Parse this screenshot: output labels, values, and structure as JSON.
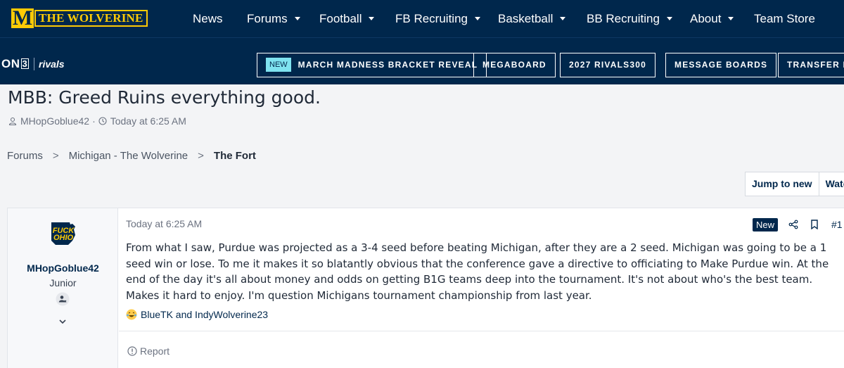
{
  "header": {
    "logo_letter": "M",
    "logo_text": "THE WOLVERINE",
    "nav": [
      {
        "label": "News",
        "has_caret": false
      },
      {
        "label": "Forums",
        "has_caret": true
      },
      {
        "label": "Football",
        "has_caret": true
      },
      {
        "label": "FB Recruiting",
        "has_caret": true
      },
      {
        "label": "Basketball",
        "has_caret": true
      },
      {
        "label": "BB Recruiting",
        "has_caret": true
      },
      {
        "label": "About",
        "has_caret": true
      },
      {
        "label": "Team Store",
        "has_caret": false
      }
    ]
  },
  "subbar": {
    "on3_a": "ON",
    "on3_b": "3",
    "rivals": "rivals",
    "new_tag": "NEW",
    "pills": [
      "MARCH MADNESS BRACKET REVEAL",
      "MEGABOARD",
      "2027 RIVALS300",
      "MESSAGE BOARDS",
      "TRANSFER P"
    ]
  },
  "thread": {
    "title": "MBB: Greed Ruins everything good.",
    "author": "MHopGoblue42",
    "separator": "·",
    "time": "Today at 6:25 AM"
  },
  "breadcrumb": {
    "items": [
      "Forums",
      "Michigan - The Wolverine",
      "The Fort"
    ],
    "chevron": ">"
  },
  "actions": {
    "jump_to_new": "Jump to new",
    "watch": "Watch"
  },
  "post": {
    "avatar_text_1": "FUCK",
    "avatar_text_2": "OHIO",
    "username": "MHopGoblue42",
    "user_title": "Junior",
    "date": "Today at 6:25 AM",
    "new_label": "New",
    "number": "#1",
    "body": "From what I saw, Purdue was projected as a 3-4 seed before beating Michigan, after they are a 2 seed. Michigan was going to be a 1 seed win or lose. To me it makes it so blatantly obvious that the conference gave a directive to officiating to Make Purdue win. At the end of the day it's all about money and odds on getting B1G teams deep into the tournament. It's not about who's the best team. Makes it hard to enjoy. I'm question Michigans tournament championship from last year.",
    "reactions": "BlueTK and IndyWolverine23",
    "report": "Report"
  },
  "colors": {
    "navy": "#00274c",
    "maize": "#ffcb05",
    "new_tag": "#7fe3f0"
  },
  "icons": [
    "user-icon",
    "clock-icon",
    "share-icon",
    "bookmark-icon",
    "chevron-down-icon",
    "user-badge-icon",
    "laughing-emoji-icon",
    "report-icon"
  ]
}
